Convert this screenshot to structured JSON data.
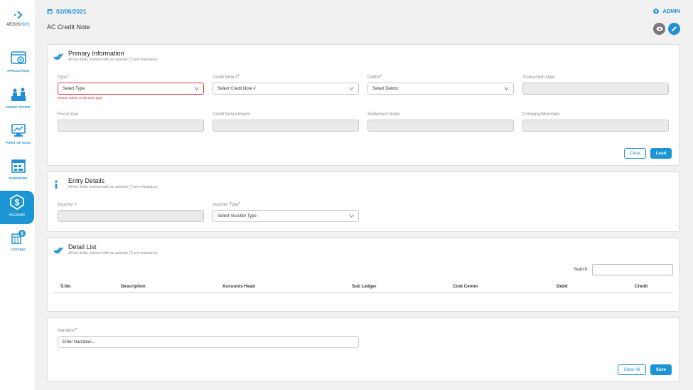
{
  "brand": {
    "name_main": "AEGIS",
    "name_accent": "HMS"
  },
  "sidebar": {
    "items": [
      {
        "label": "APPLICATION"
      },
      {
        "label": "FRONT OFFICE"
      },
      {
        "label": "POINT OF SALE"
      },
      {
        "label": "INVENTORY"
      },
      {
        "label": "ACCOUNT"
      },
      {
        "label": "COSTING"
      }
    ]
  },
  "header": {
    "date": "02/06/2021",
    "user": "ADMIN",
    "page_title": "AC Credit Note"
  },
  "mandatory_note": "All the fields marked with an asterisk (*) are mandatory.",
  "primary": {
    "title": "Primary Information",
    "fields": {
      "type": {
        "label": "Type",
        "value": "Select Type",
        "error": "Please select credit note type."
      },
      "credit_note_no": {
        "label": "Credit Note #",
        "value": "Select Credit Note #"
      },
      "debtor": {
        "label": "Debtor",
        "value": "Select Debtor"
      },
      "transaction_date": {
        "label": "Transaction Date",
        "value": ""
      },
      "fiscal_year": {
        "label": "Fiscal Year",
        "value": ""
      },
      "credit_note_amount": {
        "label": "Credit Note Amount",
        "value": ""
      },
      "settlement_mode": {
        "label": "Settlement Mode",
        "value": ""
      },
      "company_merchant": {
        "label": "Company/Merchant",
        "value": ""
      }
    },
    "clear_label": "Clear",
    "load_label": "Load"
  },
  "entry": {
    "title": "Entry Details",
    "fields": {
      "voucher_no": {
        "label": "Voucher #",
        "value": ""
      },
      "voucher_type": {
        "label": "Voucher Type",
        "value": "Select Voucher Type"
      }
    }
  },
  "detail": {
    "title": "Detail List",
    "search_label": "Search:",
    "columns": [
      "S.No",
      "Description",
      "Accounts Head",
      "Sub Ledger",
      "Cost Center",
      "Debit",
      "Credit"
    ]
  },
  "narration": {
    "label": "Narration",
    "placeholder": "Enter Narration...",
    "clear_all_label": "Clear All",
    "save_label": "Save"
  },
  "colors": {
    "accent": "#1b95d4",
    "error": "#d63030",
    "disabled_fill": "#eaeaea"
  }
}
